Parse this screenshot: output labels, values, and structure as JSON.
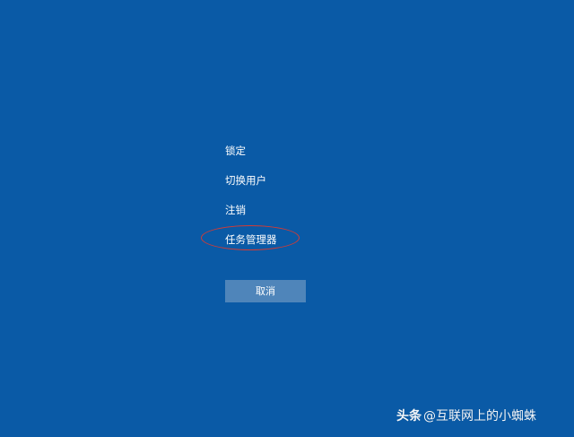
{
  "screen": {
    "background_color": "#0a5aa6"
  },
  "menu": {
    "items": [
      {
        "label": "锁定"
      },
      {
        "label": "切换用户"
      },
      {
        "label": "注销"
      },
      {
        "label": "任务管理器"
      }
    ]
  },
  "highlight": {
    "color": "#d43b34",
    "target": "任务管理器"
  },
  "cancel": {
    "label": "取消",
    "color": "#4f85ba"
  },
  "watermark": {
    "logo": "头条",
    "handle": "@互联网上的小蜘蛛"
  }
}
